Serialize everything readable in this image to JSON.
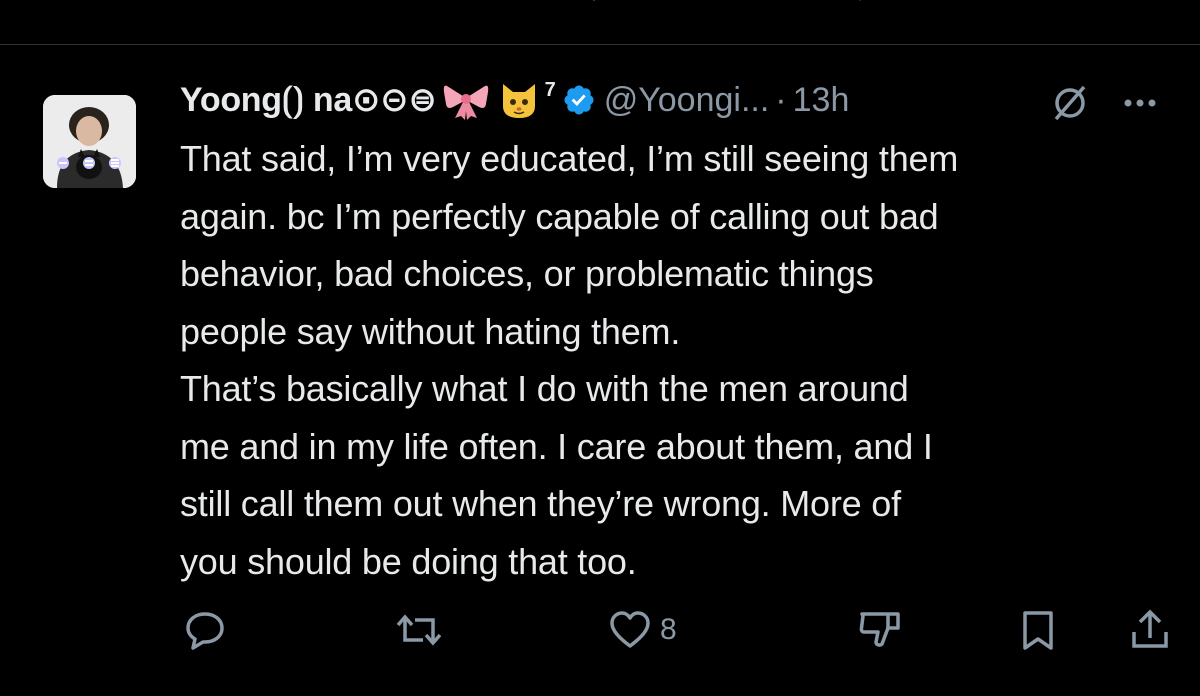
{
  "tweet": {
    "display_name": "Yoong⟮⟯ na⊙⊝⊜",
    "emoji_after_name": [
      "ribbon",
      "cat-face"
    ],
    "superscript": "7",
    "handle": "@Yoongi...",
    "separator": "·",
    "time": "13h",
    "body_lines": [
      "That said, I’m very educated, I’m still seeing them",
      "again. bc  I’m perfectly capable of calling out bad",
      "behavior, bad choices, or problematic things",
      "people say without hating them.",
      "That’s basically what I do with the men around",
      "me and in my life often. I care about them, and I",
      "still call them out when they’re wrong. More of",
      "you should be doing that too."
    ],
    "like_count": "8",
    "icons": {
      "reply": "reply-icon",
      "repost": "repost-icon",
      "like": "heart-icon",
      "dislike": "thumbs-down-icon",
      "bookmark": "bookmark-icon",
      "share": "share-icon",
      "more": "more-icon",
      "mute": "mute-icon",
      "verified": "verified-badge-icon"
    }
  },
  "colors": {
    "background": "#000000",
    "text": "#e7e9ea",
    "muted": "#8b98a5",
    "verified": "#1d9bf0",
    "divider": "#2f3336"
  }
}
